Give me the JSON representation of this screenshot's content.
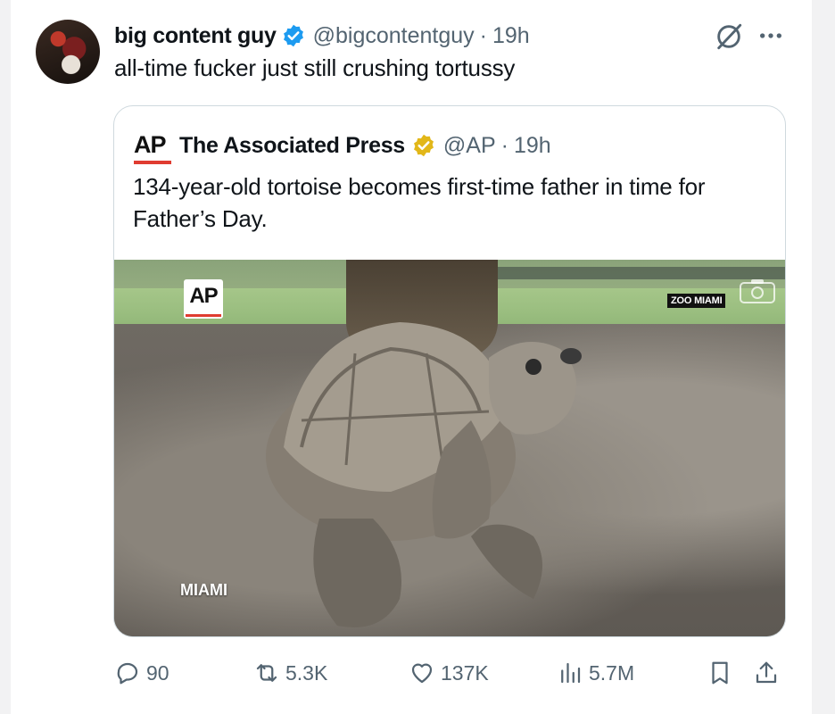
{
  "author": {
    "name": "big content guy",
    "handle": "@bigcontentguy",
    "separator": "·",
    "time": "19h",
    "verified_color": "#1d9bf0"
  },
  "tweet_text": "all-time fucker just still crushing tortussy",
  "quoted": {
    "logo_text": "AP",
    "name": "The Associated Press",
    "handle": "@AP",
    "separator": "·",
    "time": "19h",
    "verified_color": "#e2b719",
    "text": "134-year-old tortoise becomes first-time father in time for Father’s Day.",
    "media": {
      "badge": "AP",
      "watermark": "ZOO MIAMI",
      "location": "MIAMI"
    }
  },
  "actions": {
    "replies": "90",
    "reposts": "5.3K",
    "likes": "137K",
    "views": "5.7M"
  },
  "icons": {
    "reply": "reply-icon",
    "repost": "repost-icon",
    "like": "heart-icon",
    "views": "views-icon",
    "bookmark": "bookmark-icon",
    "share": "share-icon",
    "grok": "grok-icon",
    "more": "more-icon",
    "camera": "camera-icon"
  }
}
